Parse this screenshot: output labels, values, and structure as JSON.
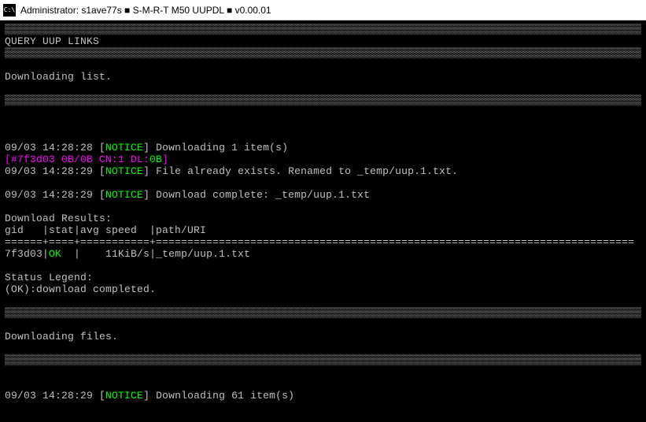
{
  "titlebar": {
    "icon_text": "C:\\",
    "title": "Administrator:  s1ave77s ■ S-M-R-T M50 UUPDL ■ v0.00.01"
  },
  "blockchar_line": "▒▒▒▒▒▒▒▒▒▒▒▒▒▒▒▒▒▒▒▒▒▒▒▒▒▒▒▒▒▒▒▒▒▒▒▒▒▒▒▒▒▒▒▒▒▒▒▒▒▒▒▒▒▒▒▒▒▒▒▒▒▒▒▒▒▒▒▒▒▒▒▒▒▒▒▒▒▒▒▒▒▒▒▒▒▒▒▒▒▒▒▒▒▒▒▒▒▒▒▒▒▒▒▒▒▒▒▒▒▒",
  "separator_line": "======+====+===========+============================================================================",
  "texts": {
    "query_title": "QUERY UUP LINKS",
    "downloading_list": "Downloading list.",
    "downloading_files": "Downloading files.",
    "download_results": "Download Results:",
    "table_header": "gid   |stat|avg speed  |path/URI",
    "status_legend": "Status Legend:",
    "legend_ok": "(OK):download completed."
  },
  "log": {
    "l1": {
      "ts": "09/03 14:28:28 ",
      "lb": "[",
      "notice": "NOTICE",
      "rb": "] ",
      "msg": "Downloading 1 item(s)"
    },
    "progress": {
      "lb": "[",
      "hash": "#7f3d03 0B/0B CN:1 DL:",
      "dl": "0B",
      "rb": "]"
    },
    "l2": {
      "ts": "09/03 14:28:29 ",
      "lb": "[",
      "notice": "NOTICE",
      "rb": "] ",
      "msg": "File already exists. Renamed to _temp/uup.1.txt."
    },
    "l3": {
      "ts": "09/03 14:28:29 ",
      "lb": "[",
      "notice": "NOTICE",
      "rb": "] ",
      "msg": "Download complete: _temp/uup.1.txt"
    },
    "row": {
      "gid": "7f3d03",
      "pipe": "|",
      "ok": "OK",
      "rest": "  |    11KiB/s|_temp/uup.1.txt"
    },
    "l4": {
      "ts": "09/03 14:28:29 ",
      "lb": "[",
      "notice": "NOTICE",
      "rb": "] ",
      "msg": "Downloading 61 item(s)"
    }
  }
}
